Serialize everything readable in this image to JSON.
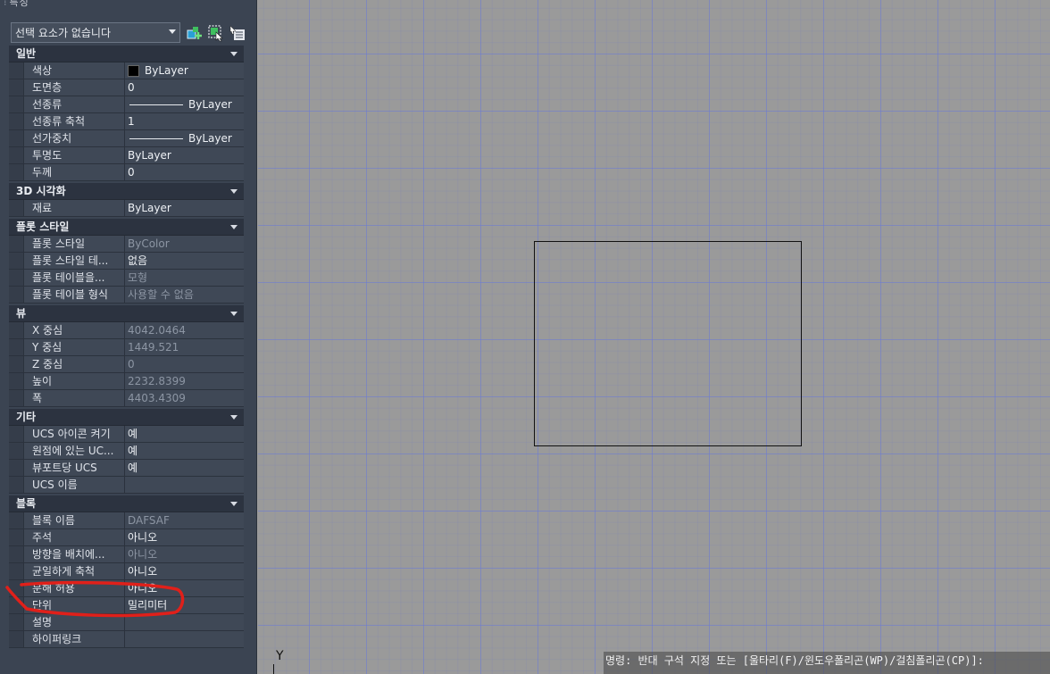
{
  "palette": {
    "title": "특성",
    "selection_dropdown": "선택 요소가 없습니다",
    "sections": [
      {
        "header": "일반",
        "rows": [
          {
            "name": "색상",
            "value": "ByLayer",
            "kind": "color",
            "dim": false
          },
          {
            "name": "도면층",
            "value": "0",
            "dim": false
          },
          {
            "name": "선종류",
            "value": "ByLayer",
            "kind": "line",
            "dim": false
          },
          {
            "name": "선종류 축척",
            "value": "1",
            "dim": false
          },
          {
            "name": "선가중치",
            "value": "ByLayer",
            "kind": "line",
            "dim": false
          },
          {
            "name": "투명도",
            "value": "ByLayer",
            "dim": false
          },
          {
            "name": "두께",
            "value": "0",
            "dim": false
          }
        ]
      },
      {
        "header": "3D 시각화",
        "rows": [
          {
            "name": "재료",
            "value": "ByLayer",
            "dim": false
          }
        ]
      },
      {
        "header": "플롯 스타일",
        "rows": [
          {
            "name": "플롯 스타일",
            "value": "ByColor",
            "dim": true
          },
          {
            "name": "플롯 스타일 테...",
            "value": "없음",
            "dim": false
          },
          {
            "name": "플롯 테이블을...",
            "value": "모형",
            "dim": true
          },
          {
            "name": "플롯 테이블 형식",
            "value": "사용할 수 없음",
            "dim": true
          }
        ]
      },
      {
        "header": "뷰",
        "rows": [
          {
            "name": "X 중심",
            "value": "4042.0464",
            "dim": true
          },
          {
            "name": "Y 중심",
            "value": "1449.521",
            "dim": true
          },
          {
            "name": "Z 중심",
            "value": "0",
            "dim": true
          },
          {
            "name": "높이",
            "value": "2232.8399",
            "dim": true
          },
          {
            "name": "폭",
            "value": "4403.4309",
            "dim": true
          }
        ]
      },
      {
        "header": "기타",
        "rows": [
          {
            "name": "UCS 아이콘 켜기",
            "value": "예",
            "dim": false
          },
          {
            "name": "원점에 있는 UC...",
            "value": "예",
            "dim": false
          },
          {
            "name": "뷰포트당 UCS",
            "value": "예",
            "dim": false
          },
          {
            "name": "UCS 이름",
            "value": "",
            "dim": false
          }
        ]
      },
      {
        "header": "블록",
        "rows": [
          {
            "name": "블록 이름",
            "value": "DAFSAF",
            "dim": true
          },
          {
            "name": "주석",
            "value": "아니오",
            "dim": false
          },
          {
            "name": "방향을 배치에...",
            "value": "아니오",
            "dim": true
          },
          {
            "name": "균일하게 축척",
            "value": "아니오",
            "dim": false
          },
          {
            "name": "분해 허용",
            "value": "아니오",
            "dim": false
          },
          {
            "name": "단위",
            "value": "밀리미터",
            "dim": false
          },
          {
            "name": "설명",
            "value": "",
            "dim": false
          },
          {
            "name": "하이퍼링크",
            "value": "",
            "dim": false
          }
        ]
      }
    ]
  },
  "canvas": {
    "ucs_label": "Y",
    "command_line": "명령: 반대 구석 지정 또는 [울타리(F)/윈도우폴리곤(WP)/걸침폴리곤(CP)]:"
  },
  "colors": {
    "annotation": "#e0201a"
  }
}
